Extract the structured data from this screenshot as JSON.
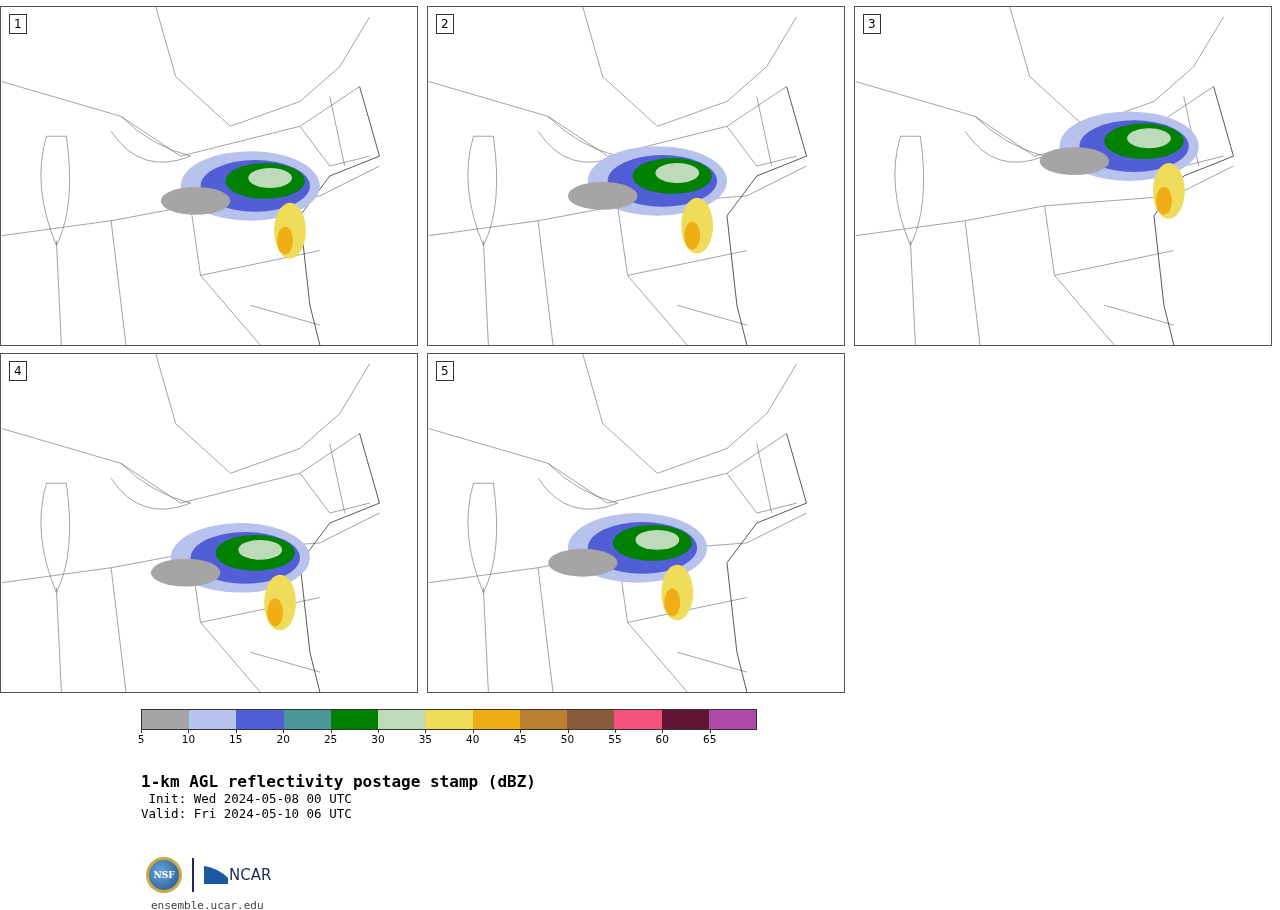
{
  "panels": [
    {
      "label": "1"
    },
    {
      "label": "2"
    },
    {
      "label": "3"
    },
    {
      "label": "4"
    },
    {
      "label": "5"
    }
  ],
  "colorbar": {
    "segments": [
      {
        "color": "#a5a5a5"
      },
      {
        "color": "#b7c3ed"
      },
      {
        "color": "#515ed6"
      },
      {
        "color": "#4c9598"
      },
      {
        "color": "#008200"
      },
      {
        "color": "#bddbbb"
      },
      {
        "color": "#eedc5a"
      },
      {
        "color": "#eeae14"
      },
      {
        "color": "#b9812f"
      },
      {
        "color": "#8a5a3d"
      },
      {
        "color": "#f5517c"
      },
      {
        "color": "#611535"
      },
      {
        "color": "#ae4aa9"
      }
    ],
    "ticks": [
      "5",
      "10",
      "15",
      "20",
      "25",
      "30",
      "35",
      "40",
      "45",
      "50",
      "55",
      "60",
      "65"
    ]
  },
  "title": "1-km AGL reflectivity postage stamp (dBZ)",
  "init": " Init: Wed 2024-05-08 00 UTC",
  "valid": "Valid: Fri 2024-05-10 06 UTC",
  "logos": {
    "nsf": "NSF",
    "ncar": "NCAR"
  },
  "url": "ensemble.ucar.edu"
}
